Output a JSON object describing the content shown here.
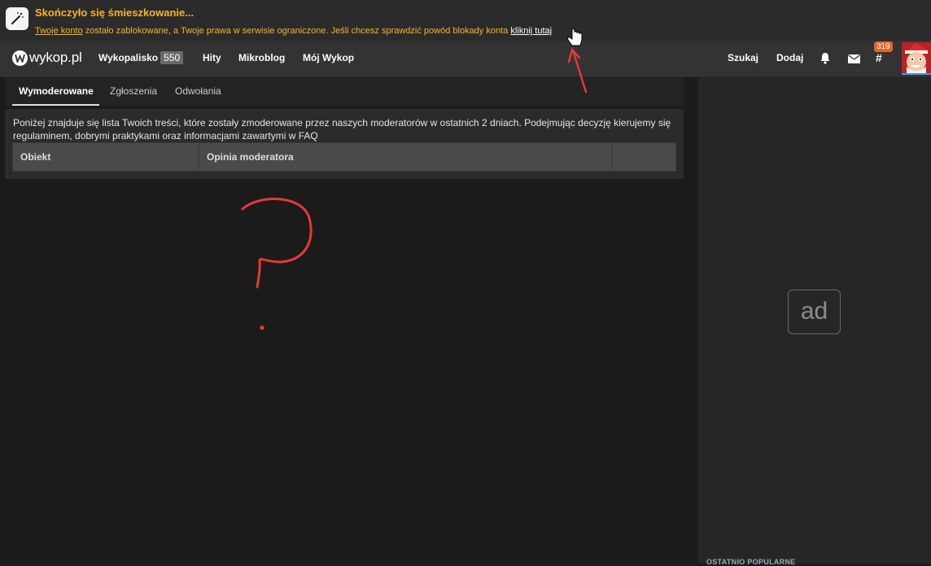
{
  "alert": {
    "title": "Skończyło się śmieszkowanie...",
    "account_link": "Twoje konto",
    "message": " zostało zablokowane, a Twoje prawa w serwisie ograniczone. Jeśli chcesz sprawdzić powód blokady konta ",
    "here_link": "kliknij tutaj"
  },
  "nav": {
    "logo_text": "wykop.pl",
    "links": [
      {
        "label": "Wykopalisko",
        "count": "550"
      },
      {
        "label": "Hity"
      },
      {
        "label": "Mikroblog"
      },
      {
        "label": "Mój Wykop"
      }
    ],
    "search_label": "Szukaj",
    "add_label": "Dodaj",
    "tags_badge": "319",
    "hash_symbol": "#"
  },
  "tabs": [
    {
      "label": "Wymoderowane",
      "active": true
    },
    {
      "label": "Zgłoszenia",
      "active": false
    },
    {
      "label": "Odwołania",
      "active": false
    }
  ],
  "panel": {
    "description": "Poniżej znajduje się lista Twoich treści, które zostały zmoderowane przez naszych moderatorów w ostatnich 2 dniach. Podejmując decyzję kierujemy się regulaminem, dobrymi praktykami oraz informacjami zawartymi w FAQ",
    "columns": [
      "Obiekt",
      "Opinia moderatora",
      ""
    ]
  },
  "sidebar": {
    "ad_label": "ad",
    "section_label": "OSTATNIO POPULARNE"
  },
  "colors": {
    "accent_orange": "#f7b32b",
    "badge_orange": "#e0652b",
    "annotation_red": "#e53935"
  }
}
